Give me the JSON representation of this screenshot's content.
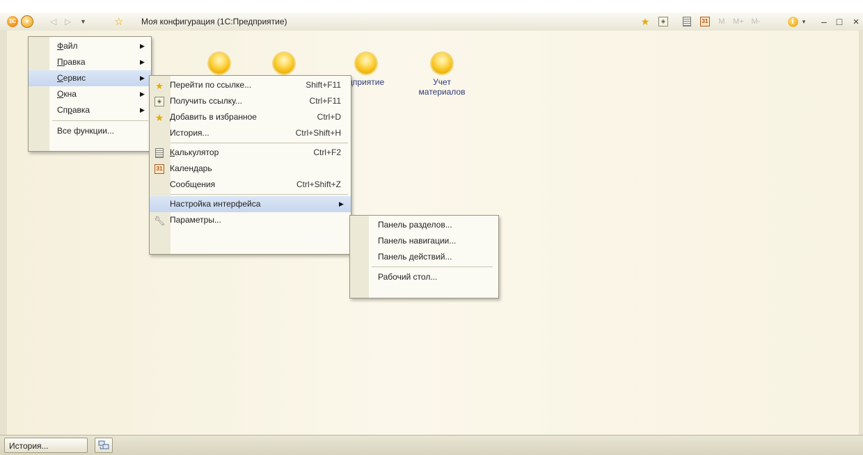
{
  "window": {
    "title": "Моя конфигурация  (1С:Предприятие)"
  },
  "toolbar": {
    "logo_text": "1С",
    "mainmenu_glyph": "▾",
    "back_glyph": "◁",
    "forward_glyph": "▷",
    "history_glyph": "▼",
    "favorite_glyph": "☆",
    "right": {
      "fav_link_glyph": "★",
      "get_link_glyph": "◈",
      "calendar_text": "31",
      "m_text": "M",
      "mplus_text": "M+",
      "mminus_text": "M-",
      "info_glyph": "i",
      "info_drop_glyph": "▾",
      "minimize_glyph": "–",
      "maximize_glyph": "□",
      "close_glyph": "×"
    },
    "accent_color": "#f08a10"
  },
  "desktop": {
    "sections": [
      {
        "label": ""
      },
      {
        "label": ""
      },
      {
        "label": "дприятие"
      },
      {
        "label": "Учет\nматериалов"
      }
    ]
  },
  "main_menu": {
    "items": [
      {
        "label": "Файл",
        "underline": "Ф",
        "rest": "айл",
        "submenu": true
      },
      {
        "label": "Правка",
        "underline": "П",
        "rest": "равка",
        "submenu": true
      },
      {
        "label": "Сервис",
        "underline": "С",
        "rest": "ервис",
        "submenu": true,
        "active": true
      },
      {
        "label": "Окна",
        "underline": "О",
        "rest": "кна",
        "submenu": true
      },
      {
        "label": "Справка",
        "pre": "Сп",
        "underline": "р",
        "rest": "авка",
        "submenu": true
      },
      {
        "label": "Все функции..."
      }
    ],
    "arrow_glyph": "▶"
  },
  "service_menu": {
    "items": [
      {
        "label": "Перейти по ссылке...",
        "shortcut": "Shift+F11",
        "icon": "star-arrow-icon"
      },
      {
        "label": "Получить ссылку...",
        "shortcut": "Ctrl+F11",
        "icon": "link-icon"
      },
      {
        "label": "Добавить в избранное",
        "shortcut": "Ctrl+D",
        "icon": "star-plus-icon"
      },
      {
        "label": "История...",
        "shortcut": "Ctrl+Shift+H"
      },
      {
        "label": "Калькулятор",
        "underline": "К",
        "rest": "алькулятор",
        "shortcut": "Ctrl+F2",
        "icon": "calculator-icon"
      },
      {
        "label": "Календарь",
        "pre": "Кален",
        "underline": "д",
        "rest": "арь",
        "icon": "calendar-icon"
      },
      {
        "label": "Сообщения",
        "shortcut": "Ctrl+Shift+Z"
      },
      {
        "label": "Настройка интерфейса",
        "submenu": true,
        "active": true
      },
      {
        "label": "Параметры...",
        "icon": "wrench-icon"
      }
    ],
    "calendar_icon_text": "31"
  },
  "interface_menu": {
    "items": [
      {
        "label": "Панель разделов..."
      },
      {
        "label": "Панель навигации..."
      },
      {
        "label": "Панель действий..."
      },
      {
        "label": "Рабочий стол..."
      }
    ]
  },
  "statusbar": {
    "history_label": "История..."
  },
  "colors": {
    "highlight": "#c7d7ef",
    "menu_bg": "#fbfaf3",
    "desktop_bg": "#fbf7ea",
    "section_link": "#2c3a7a"
  }
}
